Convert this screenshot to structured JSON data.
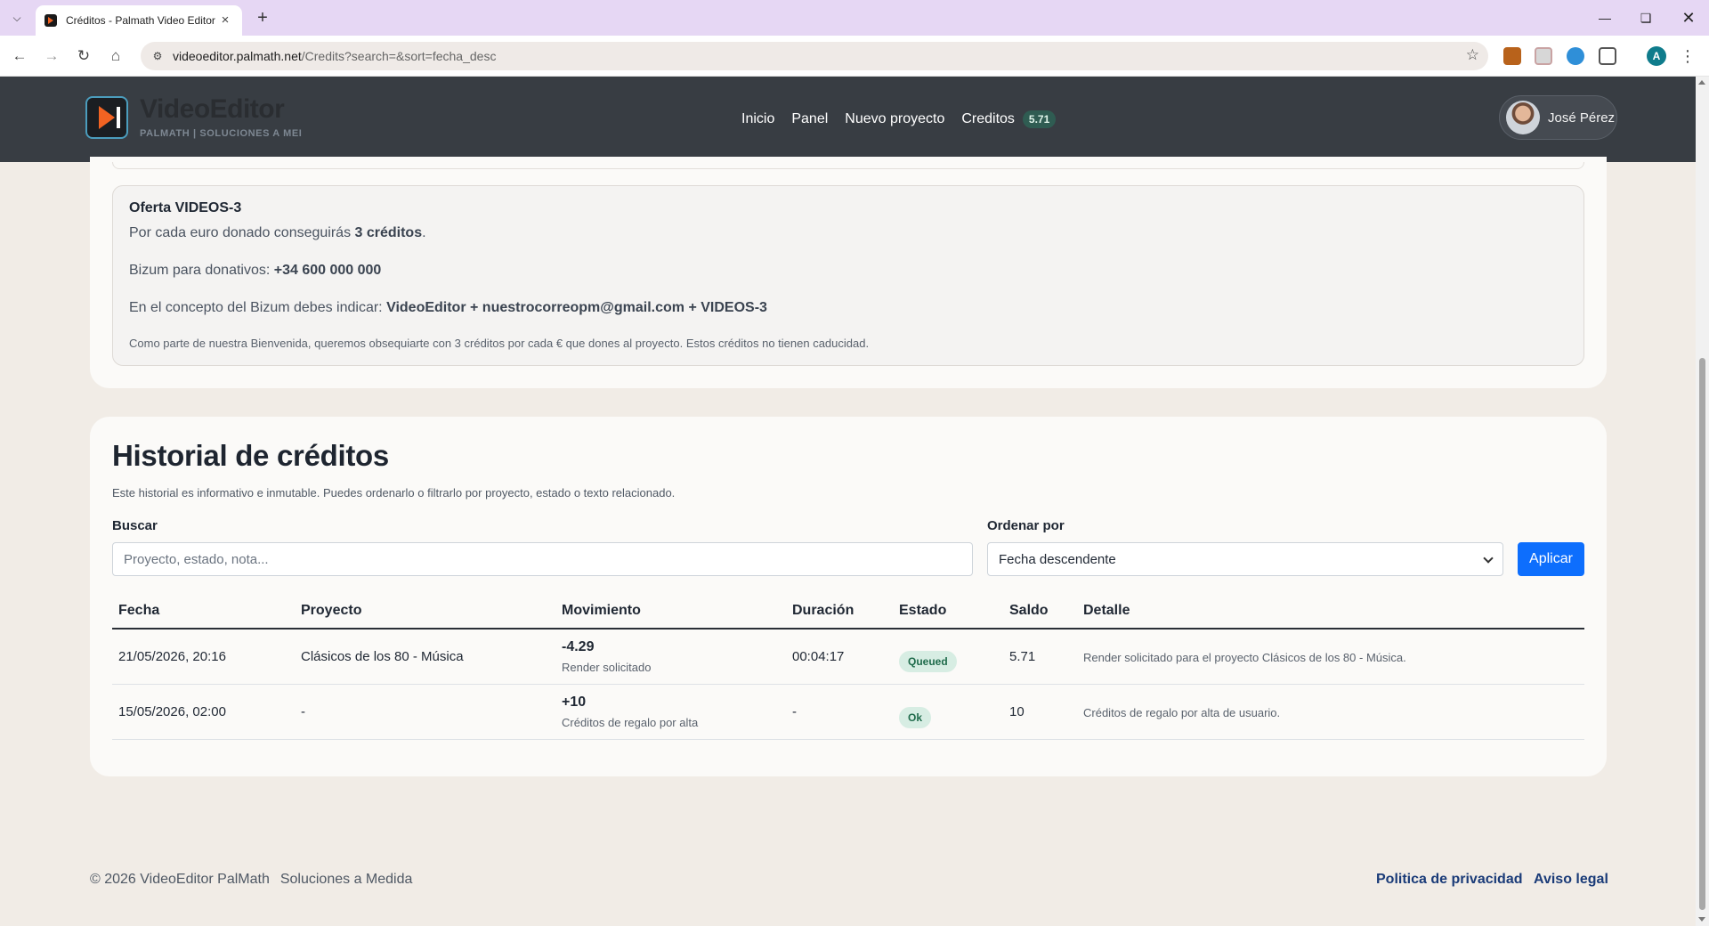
{
  "browser": {
    "tab_title": "Créditos - Palmath Video Editor",
    "tab_close": "×",
    "new_tab": "+",
    "url_host": "videoeditor.palmath.net",
    "url_path": "/Credits?search=&sort=fecha_desc",
    "profile_initial": "A"
  },
  "header": {
    "brand_name": "VideoEditor",
    "brand_sub": "PALMATH | SOLUCIONES A MEI",
    "nav": [
      "Inicio",
      "Panel",
      "Nuevo proyecto",
      "Creditos"
    ],
    "credit_balance": "5.71",
    "user_name": "José Pérez"
  },
  "offer": {
    "title": "Oferta VIDEOS-3",
    "line1_pre": "Por cada euro donado conseguirás ",
    "line1_bold": "3 créditos",
    "line1_post": ".",
    "line2_pre": "Bizum para donativos: ",
    "line2_bold": "+34 600 000 000",
    "line3_pre": "En el concepto del Bizum debes indicar: ",
    "line3_bold": "VideoEditor + nuestrocorreopm@gmail.com + VIDEOS-3",
    "note": "Como parte de nuestra Bienvenida, queremos obsequiarte con 3 créditos por cada € que dones al proyecto. Estos créditos no tienen caducidad."
  },
  "history": {
    "title": "Historial de créditos",
    "description": "Este historial es informativo e inmutable. Puedes ordenarlo o filtrarlo por proyecto, estado o texto relacionado.",
    "search_label": "Buscar",
    "search_placeholder": "Proyecto, estado, nota...",
    "search_value": "",
    "sort_label": "Ordenar por",
    "sort_value": "Fecha descendente",
    "apply_label": "Aplicar",
    "columns": [
      "Fecha",
      "Proyecto",
      "Movimiento",
      "Duración",
      "Estado",
      "Saldo",
      "Detalle"
    ],
    "rows": [
      {
        "fecha": "21/05/2026, 20:16",
        "proyecto": "Clásicos de los 80 - Música",
        "movimiento": "-4.29",
        "movimiento_note": "Render solicitado",
        "duracion": "00:04:17",
        "estado": "Queued",
        "saldo": "5.71",
        "detalle": "Render solicitado para el proyecto Clásicos de los 80 - Música."
      },
      {
        "fecha": "15/05/2026, 02:00",
        "proyecto": "-",
        "movimiento": "+10",
        "movimiento_note": "Créditos de regalo por alta",
        "duracion": "-",
        "estado": "Ok",
        "saldo": "10",
        "detalle": "Créditos de regalo por alta de usuario."
      }
    ]
  },
  "footer": {
    "copyright": "© 2026 VideoEditor PalMath",
    "tagline": "Soluciones a Medida",
    "privacy": "Politica de privacidad",
    "legal": "Aviso legal"
  },
  "colors": {
    "header_bg": "#383d43",
    "accent": "#0d6efd",
    "badge_queued_bg": "#d7ede3",
    "badge_ok_bg": "#d7ede3",
    "footer_link": "#1a3b78"
  }
}
